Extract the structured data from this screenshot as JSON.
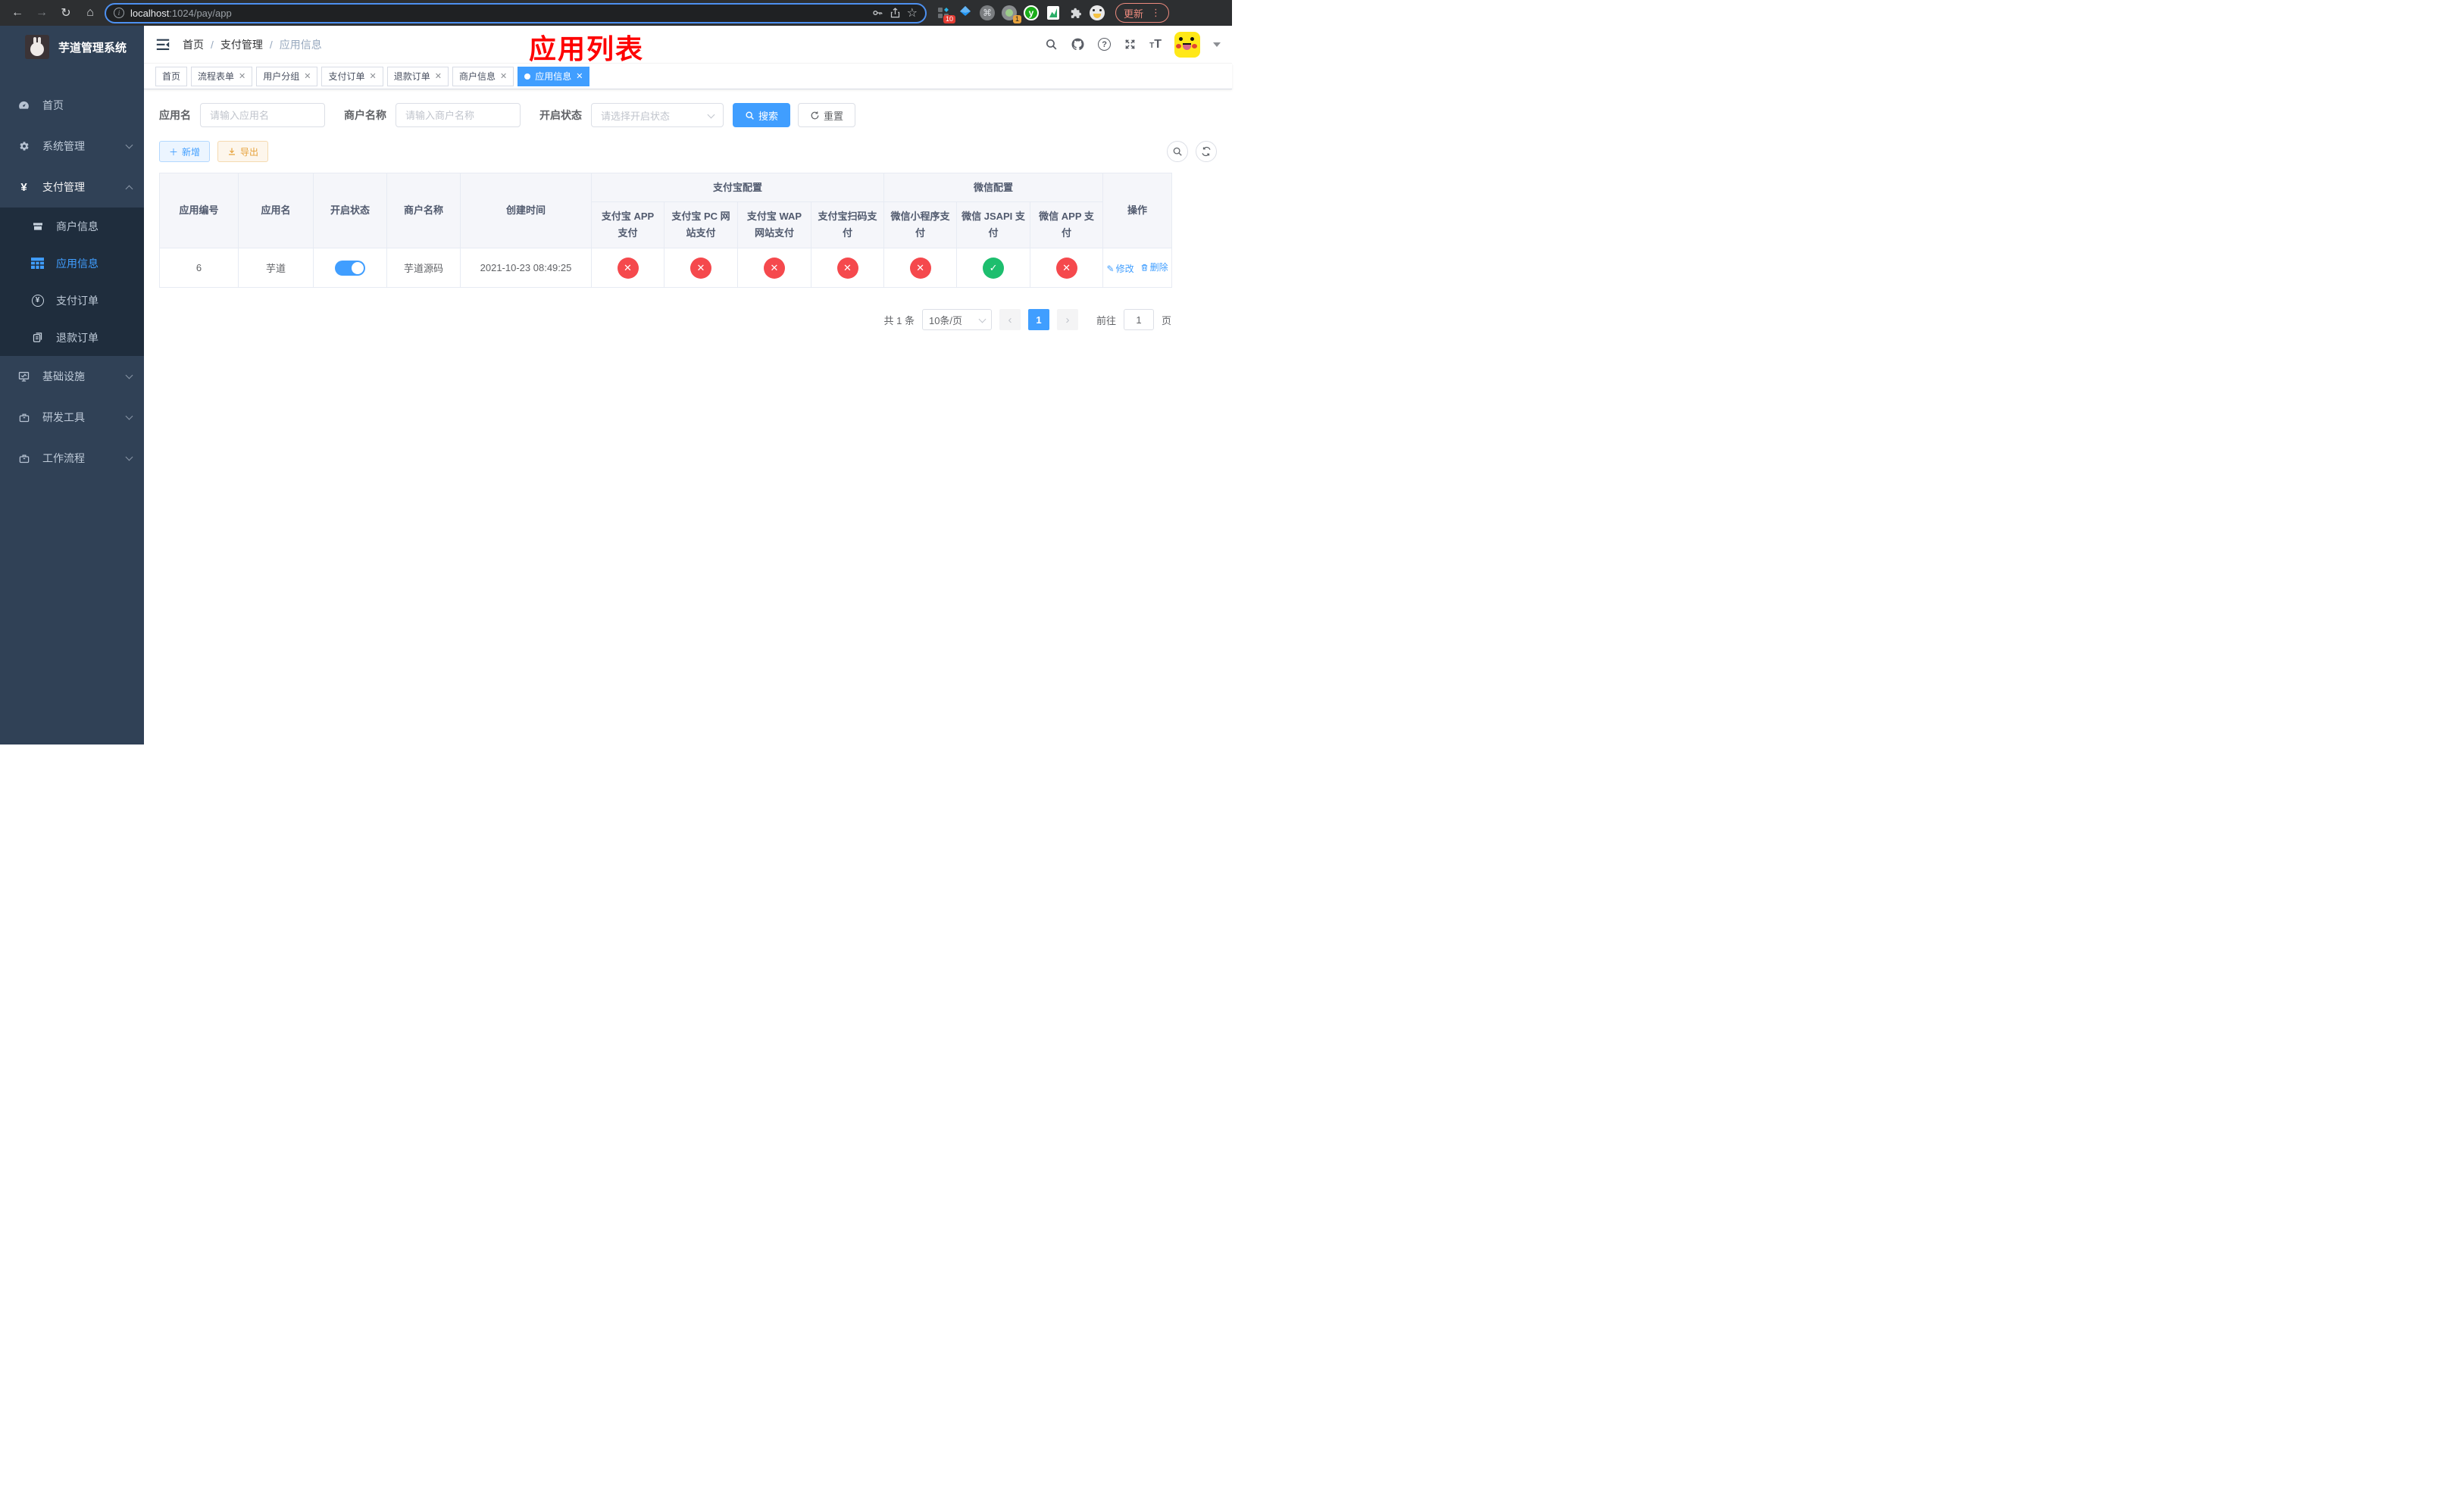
{
  "browser": {
    "url_host": "localhost",
    "url_path": ":1024/pay/app",
    "update_label": "更新",
    "extension_badge_pinned": "10",
    "extension_badge_record": "1",
    "extension_letter_y": "y"
  },
  "sidebar": {
    "title": "芋道管理系统",
    "menu": [
      {
        "label": "首页"
      },
      {
        "label": "系统管理"
      },
      {
        "label": "支付管理"
      },
      {
        "label": "基础设施"
      },
      {
        "label": "研发工具"
      },
      {
        "label": "工作流程"
      }
    ],
    "submenu": [
      {
        "label": "商户信息"
      },
      {
        "label": "应用信息"
      },
      {
        "label": "支付订单"
      },
      {
        "label": "退款订单"
      }
    ]
  },
  "header": {
    "breadcrumb": [
      "首页",
      "支付管理",
      "应用信息"
    ],
    "annotation": "应用列表"
  },
  "tabs": [
    {
      "label": "首页"
    },
    {
      "label": "流程表单"
    },
    {
      "label": "用户分组"
    },
    {
      "label": "支付订单"
    },
    {
      "label": "退款订单"
    },
    {
      "label": "商户信息"
    },
    {
      "label": "应用信息"
    }
  ],
  "filters": {
    "app_name_label": "应用名",
    "app_name_placeholder": "请输入应用名",
    "merchant_label": "商户名称",
    "merchant_placeholder": "请输入商户名称",
    "status_label": "开启状态",
    "status_placeholder": "请选择开启状态",
    "search_label": "搜索",
    "reset_label": "重置"
  },
  "toolbar": {
    "add_label": "新增",
    "export_label": "导出"
  },
  "table": {
    "headers": {
      "id": "应用编号",
      "name": "应用名",
      "status": "开启状态",
      "merchant": "商户名称",
      "created": "创建时间",
      "alipay_group": "支付宝配置",
      "wechat_group": "微信配置",
      "actions": "操作"
    },
    "channel_headers": [
      "支付宝 APP 支付",
      "支付宝 PC 网站支付",
      "支付宝 WAP 网站支付",
      "支付宝扫码支付",
      "微信小程序支付",
      "微信 JSAPI 支付",
      "微信 APP 支付"
    ],
    "row": {
      "id": "6",
      "name": "芋道",
      "status_on": true,
      "merchant": "芋道源码",
      "created": "2021-10-23 08:49:25",
      "channels": [
        false,
        false,
        false,
        false,
        false,
        true,
        false
      ],
      "edit_label": "修改",
      "delete_label": "删除"
    }
  },
  "pagination": {
    "total": "共 1 条",
    "page_size": "10条/页",
    "current_page": "1",
    "goto_label": "前往",
    "goto_value": "1",
    "page_suffix": "页"
  },
  "colors": {
    "accent": "#409eff",
    "danger": "#f5494d",
    "success": "#1dbe6e",
    "sidebar_bg": "#304156",
    "submenu_bg": "#1f2d3d"
  }
}
